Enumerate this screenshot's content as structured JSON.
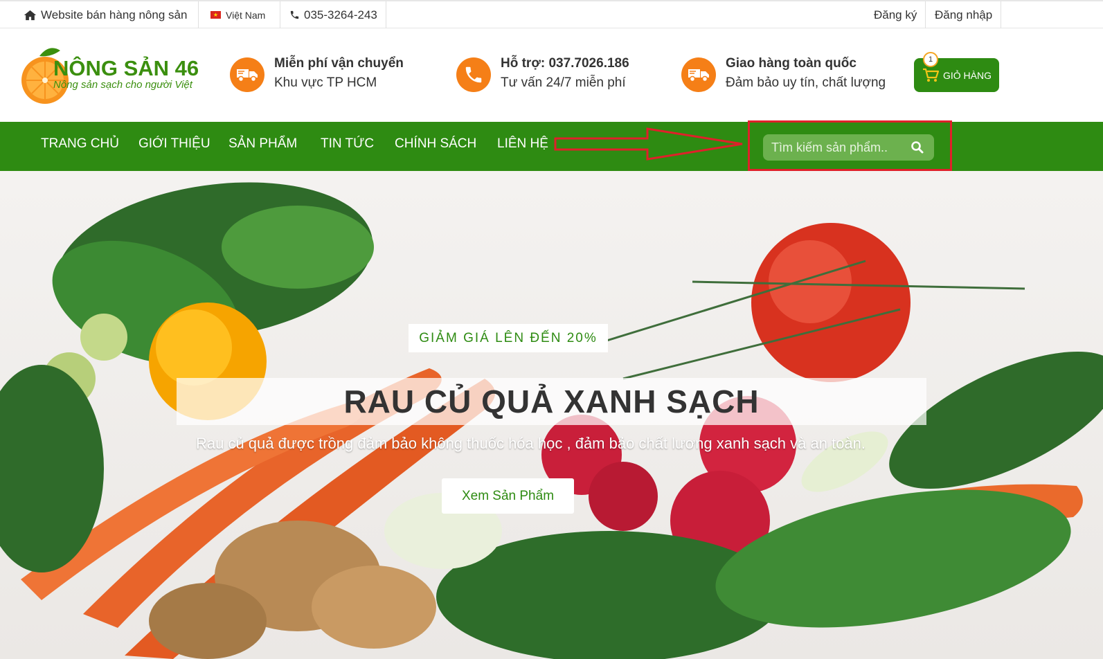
{
  "topbar": {
    "site_label": "Website bán hàng nông sản",
    "language": "Việt Nam",
    "phone": "035-3264-243",
    "register": "Đăng ký",
    "login": "Đăng nhập"
  },
  "logo": {
    "title": "NÔNG SẢN 46",
    "tagline": "Nông sản sạch cho người Việt"
  },
  "features": [
    {
      "icon": "truck-icon",
      "title": "Miễn phí vận chuyển",
      "subtitle": "Khu vực TP HCM"
    },
    {
      "icon": "phone-icon",
      "title": "Hỗ trợ: 037.7026.186",
      "subtitle": "Tư vấn 24/7 miễn phí"
    },
    {
      "icon": "truck-icon",
      "title": "Giao hàng toàn quốc",
      "subtitle": "Đảm bảo uy tín, chất lượng"
    }
  ],
  "cart": {
    "label": "GIỎ HÀNG",
    "count": "1"
  },
  "nav": {
    "items": [
      "TRANG CHỦ",
      "GIỚI THIỆU",
      "SẢN PHẨM",
      "TIN TỨC",
      "CHÍNH SÁCH",
      "LIÊN HỆ"
    ],
    "search_placeholder": "Tìm kiếm sản phẩm.."
  },
  "hero": {
    "badge": "GIẢM GIÁ LÊN ĐẾN 20%",
    "title": "RAU CỦ QUẢ XANH SẠCH",
    "subtitle": "Rau củ quả được trồng đảm bảo không thuốc hóa học , đảm bảo chất lương xanh sạch và an toàn.",
    "cta": "Xem Sản Phẩm"
  },
  "colors": {
    "brand_green": "#2e8b12",
    "accent_orange": "#f57f17",
    "annotation_red": "#e0202a"
  }
}
